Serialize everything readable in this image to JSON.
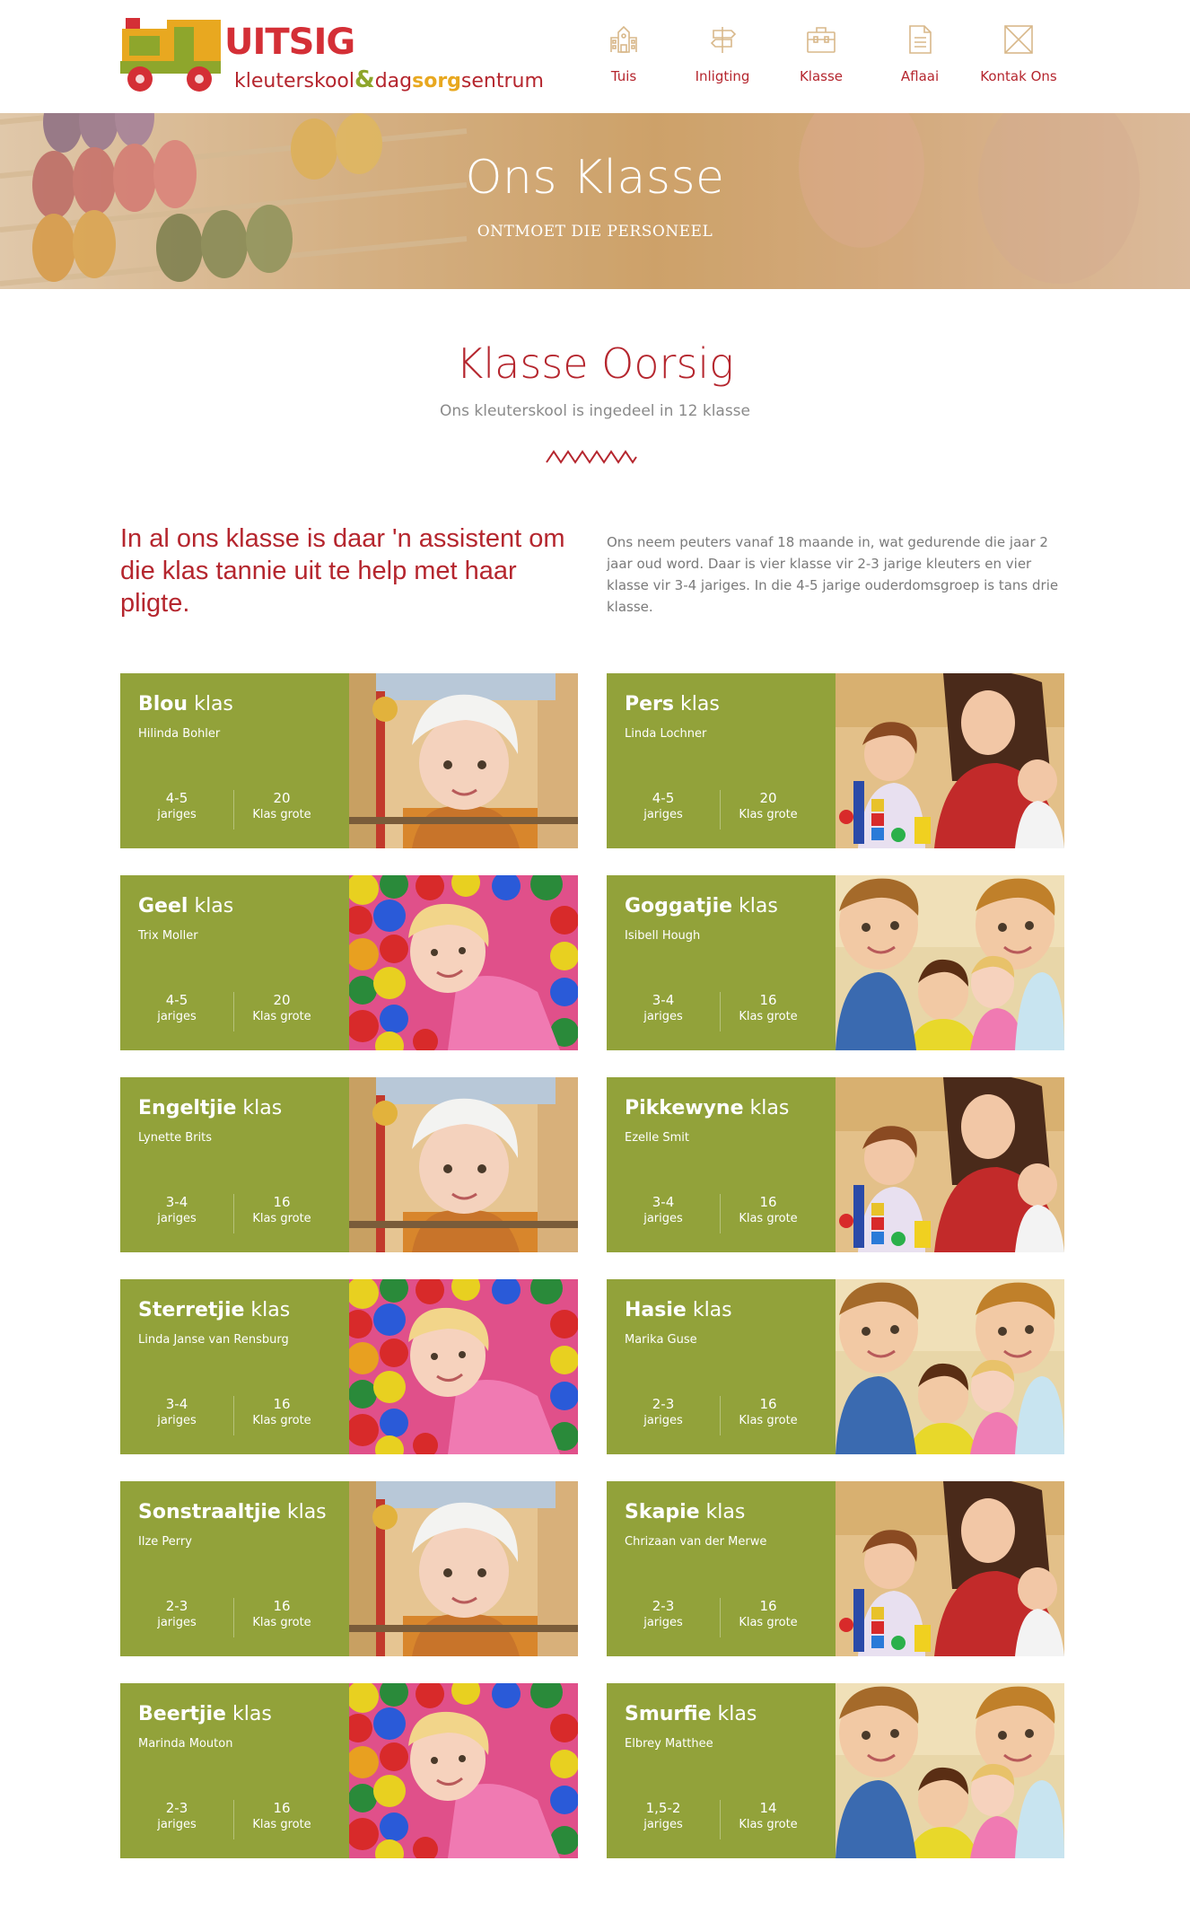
{
  "header": {
    "logo_title": "UITSIG",
    "logo_sub_1": "kleuterskool",
    "logo_amp": "&",
    "logo_sub_2": "dag",
    "logo_sub_3": "sorg",
    "logo_sub_4": "sentrum",
    "nav": [
      {
        "label": "Tuis",
        "icon": "school-building-icon"
      },
      {
        "label": "Inligting",
        "icon": "signpost-icon"
      },
      {
        "label": "Klasse",
        "icon": "briefcase-icon"
      },
      {
        "label": "Aflaai",
        "icon": "document-icon"
      },
      {
        "label": "Kontak Ons",
        "icon": "envelope-icon"
      }
    ]
  },
  "hero": {
    "title": "Ons Klasse",
    "subtitle": "ONTMOET DIE PERSONEEL"
  },
  "overview": {
    "title": "Klasse Oorsig",
    "subtitle": "Ons kleuterskool is ingedeel in 12 klasse",
    "intro_left": "In al ons klasse is daar 'n assistent om die klas tannie uit te help met haar pligte.",
    "intro_right": "Ons neem peuters vanaf 18 maande in, wat gedurende die jaar 2 jaar oud word. Daar is vier klasse vir 2-3 jarige kleuters en vier klasse vir 3-4 jariges. In die 4-5 jarige ouderdomsgroep is tans drie klasse."
  },
  "card_word": "klas",
  "age_label": "jariges",
  "size_label": "Klas grote",
  "colors": {
    "accent": "#b5262e",
    "card_green": "#92a23a"
  },
  "classes": [
    {
      "name": "Blou",
      "teacher": "Hilinda Bohler",
      "age": "4-5",
      "size": "20",
      "photo": "girl-hat"
    },
    {
      "name": "Pers",
      "teacher": "Linda Lochner",
      "age": "4-5",
      "size": "20",
      "photo": "teacher-kids"
    },
    {
      "name": "Geel",
      "teacher": "Trix Moller",
      "age": "4-5",
      "size": "20",
      "photo": "ball-pit"
    },
    {
      "name": "Goggatjie",
      "teacher": "Isibell Hough",
      "age": "3-4",
      "size": "16",
      "photo": "children-group"
    },
    {
      "name": "Engeltjie",
      "teacher": "Lynette Brits",
      "age": "3-4",
      "size": "16",
      "photo": "girl-hat"
    },
    {
      "name": "Pikkewyne",
      "teacher": "Ezelle Smit",
      "age": "3-4",
      "size": "16",
      "photo": "teacher-kids"
    },
    {
      "name": "Sterretjie",
      "teacher": "Linda Janse van Rensburg",
      "age": "3-4",
      "size": "16",
      "photo": "ball-pit"
    },
    {
      "name": "Hasie",
      "teacher": "Marika Guse",
      "age": "2-3",
      "size": "16",
      "photo": "children-group"
    },
    {
      "name": "Sonstraaltjie",
      "teacher": "Ilze Perry",
      "age": "2-3",
      "size": "16",
      "photo": "girl-hat"
    },
    {
      "name": "Skapie",
      "teacher": "Chrizaan van der Merwe",
      "age": "2-3",
      "size": "16",
      "photo": "teacher-kids"
    },
    {
      "name": "Beertjie",
      "teacher": "Marinda Mouton",
      "age": "2-3",
      "size": "16",
      "photo": "ball-pit"
    },
    {
      "name": "Smurfie",
      "teacher": "Elbrey Matthee",
      "age": "1,5-2",
      "size": "14",
      "photo": "children-group"
    }
  ]
}
